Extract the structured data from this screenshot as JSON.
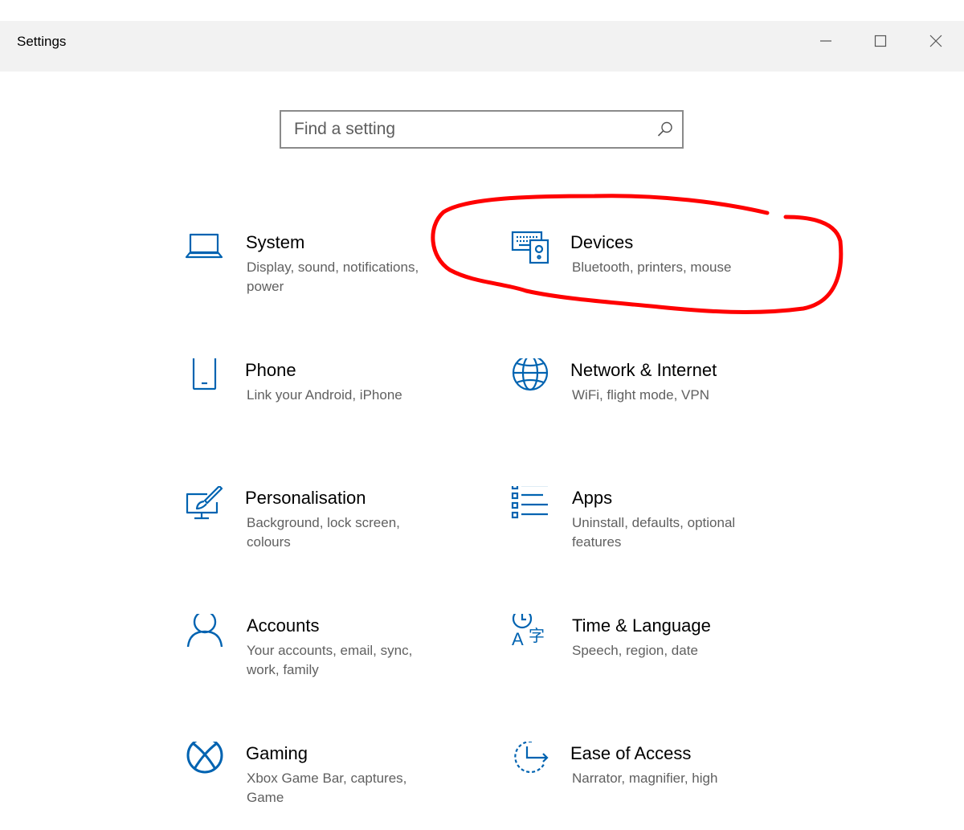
{
  "window": {
    "title": "Settings",
    "controls": {
      "minimize": "minimize-icon",
      "maximize": "maximize-icon",
      "close": "close-icon"
    }
  },
  "search": {
    "placeholder": "Find a setting",
    "icon": "search-icon"
  },
  "categories": [
    {
      "title": "System",
      "desc": "Display, sound, notifications, power",
      "icon": "laptop-icon"
    },
    {
      "title": "Devices",
      "desc": "Bluetooth, printers, mouse",
      "icon": "devices-icon"
    },
    {
      "title": "Phone",
      "desc": "Link your Android, iPhone",
      "icon": "phone-icon"
    },
    {
      "title": "Network & Internet",
      "desc": "WiFi, flight mode, VPN",
      "icon": "globe-icon"
    },
    {
      "title": "Personalisation",
      "desc": "Background, lock screen, colours",
      "icon": "paintbrush-icon"
    },
    {
      "title": "Apps",
      "desc": "Uninstall, defaults, optional features",
      "icon": "apps-list-icon"
    },
    {
      "title": "Accounts",
      "desc": "Your accounts, email, sync, work, family",
      "icon": "person-icon"
    },
    {
      "title": "Time & Language",
      "desc": "Speech, region, date",
      "icon": "time-language-icon"
    },
    {
      "title": "Gaming",
      "desc": "Xbox Game Bar, captures, Game",
      "icon": "xbox-icon"
    },
    {
      "title": "Ease of Access",
      "desc": "Narrator, magnifier, high",
      "icon": "ease-of-access-icon"
    }
  ],
  "colors": {
    "accent": "#0063b1",
    "annotation": "#ff0000",
    "titlebar": "#f2f2f2"
  }
}
